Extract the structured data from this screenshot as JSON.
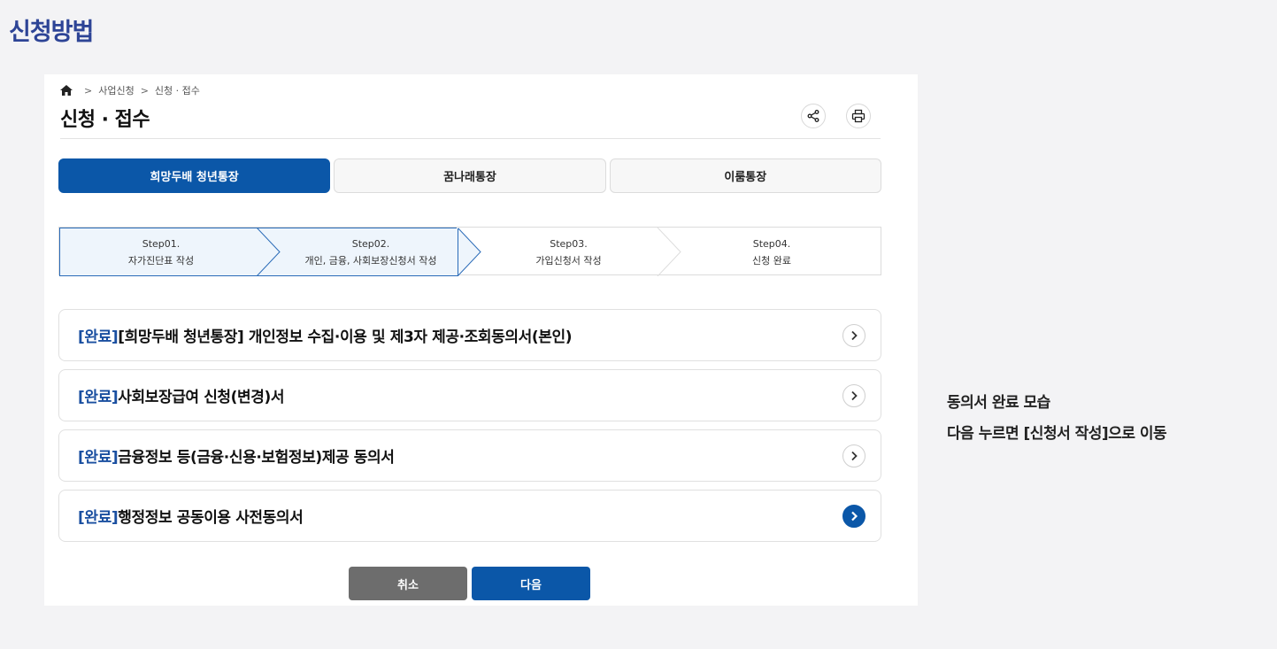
{
  "slide": {
    "title": "신청방법",
    "note_line1": "동의서 완료 모습",
    "note_line2": "다음 누르면 [신청서 작성]으로 이동"
  },
  "breadcrumb": {
    "items": [
      "사업신청",
      "신청 · 접수"
    ]
  },
  "page": {
    "title": "신청 · 접수"
  },
  "tabs": [
    {
      "label": "희망두배 청년통장",
      "active": true
    },
    {
      "label": "꿈나래통장",
      "active": false
    },
    {
      "label": "이룸통장",
      "active": false
    }
  ],
  "steps": [
    {
      "num": "Step01.",
      "label": "자가진단표 작성",
      "state": "done"
    },
    {
      "num": "Step02.",
      "label": "개인, 금융, 사회보장신청서 작성",
      "state": "current"
    },
    {
      "num": "Step03.",
      "label": "가입신청서 작성",
      "state": "todo"
    },
    {
      "num": "Step04.",
      "label": "신청 완료",
      "state": "todo"
    }
  ],
  "consents": [
    {
      "status": "[완료]",
      "title": "[희망두배 청년통장] 개인정보 수집·이용 및 제3자 제공·조회동의서(본인)"
    },
    {
      "status": "[완료]",
      "title": "사회보장급여 신청(변경)서"
    },
    {
      "status": "[완료]",
      "title": "금융정보 등(금융·신용·보험정보)제공 동의서"
    },
    {
      "status": "[완료]",
      "title": "행정정보 공동이용 사전동의서"
    }
  ],
  "buttons": {
    "cancel": "취소",
    "next": "다음"
  },
  "colors": {
    "accent": "#0b57a8",
    "title": "#2d4496",
    "cancel": "#6d6d6d",
    "step_active_bg": "#eef5fc"
  },
  "icons": [
    "home-icon",
    "share-icon",
    "print-icon",
    "chevron-right-icon"
  ]
}
